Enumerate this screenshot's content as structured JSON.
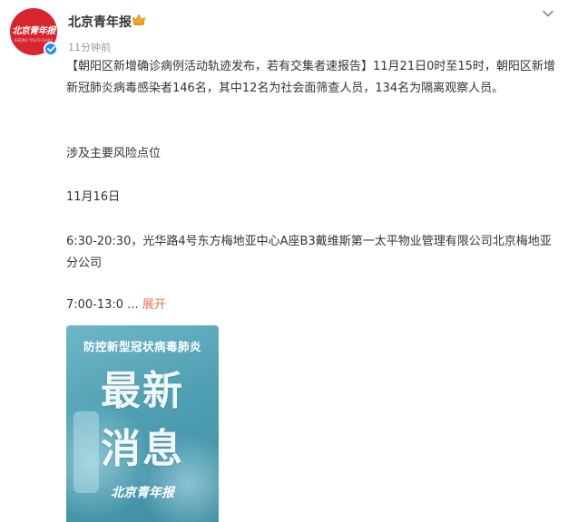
{
  "author": {
    "avatar_logo_text": "北京青年报",
    "avatar_logo_sub": "BEIJING YOUTH DAILY",
    "name": "北京青年报",
    "timestamp": "11分钟前"
  },
  "post": {
    "paragraph_1": "【朝阳区新增确诊病例活动轨迹发布，若有交集者速报告】11月21日0时至15时，朝阳区新增新冠肺炎病毒感染者146名，其中12名为社会面筛查人员，134名为隔离观察人员。",
    "paragraph_2": "涉及主要风险点位",
    "paragraph_3": "11月16日",
    "paragraph_4": "6:30-20:30，光华路4号东方梅地亚中心A座B3戴维斯第一太平物业管理有限公司北京梅地亚分公司",
    "paragraph_5": "7:00-13:0",
    "ellipsis": " ... ",
    "expand_label": "展开"
  },
  "image": {
    "headline": "防控新型冠状病毒肺炎",
    "big_line_1": "最新",
    "big_line_2": "消息",
    "logo_text": "北京青年报"
  },
  "colors": {
    "brand_red": "#d8262e",
    "verify_blue": "#1c8ff0",
    "link_orange": "#eb7350",
    "muted_text": "#999999"
  },
  "icons": {
    "verify": "verified-badge-icon",
    "crown": "crown-icon",
    "menu": "chevron-down-icon"
  }
}
